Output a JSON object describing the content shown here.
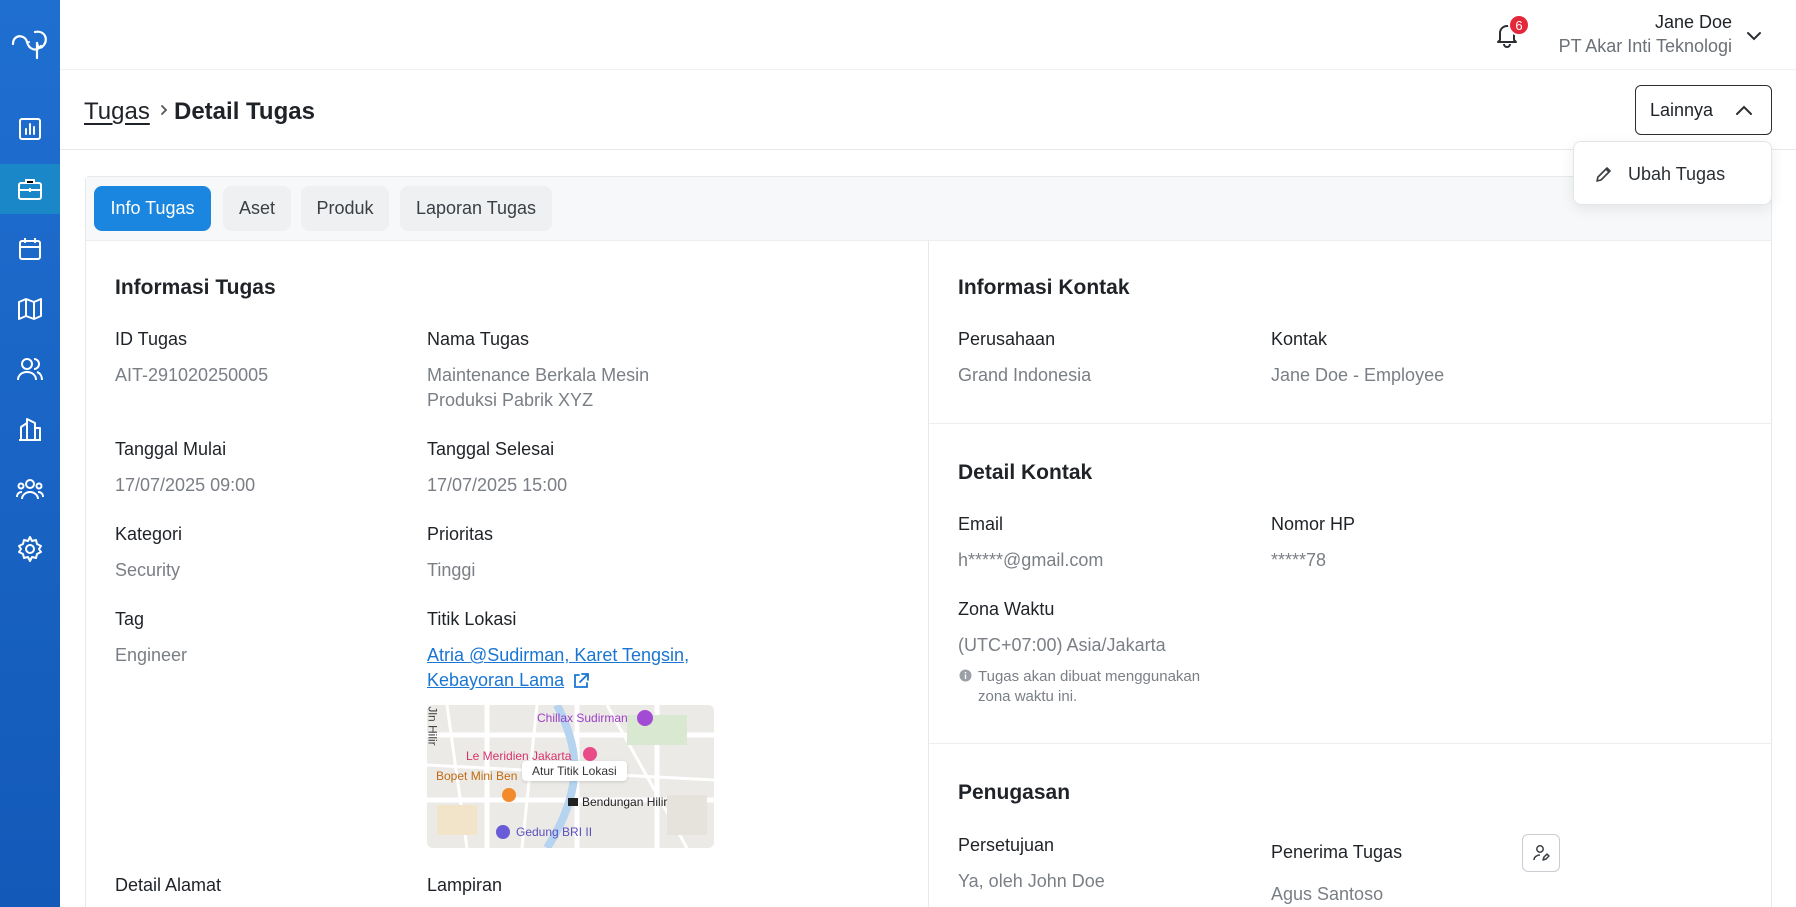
{
  "sidebar": {
    "logo": "logo-icon",
    "items": [
      {
        "icon": "chart-icon",
        "active": false
      },
      {
        "icon": "briefcase-icon",
        "active": true
      },
      {
        "icon": "calendar-icon",
        "active": false
      },
      {
        "icon": "map-icon",
        "active": false
      },
      {
        "icon": "users-icon",
        "active": false
      },
      {
        "icon": "building-icon",
        "active": false
      },
      {
        "icon": "team-icon",
        "active": false
      },
      {
        "icon": "gear-icon",
        "active": false
      }
    ]
  },
  "header": {
    "notification_count": "6",
    "user_name": "Jane Doe",
    "user_company": "PT Akar Inti Teknologi"
  },
  "breadcrumb": {
    "parent": "Tugas",
    "current": "Detail Tugas"
  },
  "actions": {
    "more_label": "Lainnya",
    "dropdown_items": [
      {
        "label": "Ubah Tugas",
        "icon": "pencil-icon"
      }
    ]
  },
  "tabs": [
    {
      "label": "Info Tugas",
      "active": true
    },
    {
      "label": "Aset",
      "active": false
    },
    {
      "label": "Produk",
      "active": false
    },
    {
      "label": "Laporan Tugas",
      "active": false
    }
  ],
  "task_info": {
    "title": "Informasi Tugas",
    "id_label": "ID Tugas",
    "id_value": "AIT-291020250005",
    "name_label": "Nama Tugas",
    "name_value_line1": "Maintenance Berkala Mesin",
    "name_value_line2": "Produksi Pabrik XYZ",
    "start_label": "Tanggal Mulai",
    "start_value": "17/07/2025 09:00",
    "end_label": "Tanggal Selesai",
    "end_value": "17/07/2025 15:00",
    "category_label": "Kategori",
    "category_value": "Security",
    "priority_label": "Prioritas",
    "priority_value": "Tinggi",
    "tag_label": "Tag",
    "tag_value": "Engineer",
    "location_label": "Titik Lokasi",
    "location_line1": "Atria @Sudirman, Karet Tengsin,",
    "location_line2": "Kebayoran Lama",
    "map": {
      "pill": "Atur Titik Lokasi",
      "places": [
        "Chillax Sudirman",
        "Le Meridien Jakarta",
        "Bopet Mini Ben",
        "Bendungan Hilir",
        "Gedung BRI II",
        "Jln Hilir"
      ]
    },
    "address_label": "Detail Alamat",
    "attachment_label": "Lampiran"
  },
  "contact_info": {
    "title": "Informasi Kontak",
    "company_label": "Perusahaan",
    "company_value": "Grand Indonesia",
    "contact_label": "Kontak",
    "contact_value": "Jane Doe - Employee"
  },
  "contact_detail": {
    "title": "Detail Kontak",
    "email_label": "Email",
    "email_value": "h*****@gmail.com",
    "phone_label": "Nomor HP",
    "phone_value": "*****78",
    "tz_label": "Zona Waktu",
    "tz_value": "(UTC+07:00) Asia/Jakarta",
    "tz_hint_line1": "Tugas akan dibuat menggunakan",
    "tz_hint_line2": "zona waktu ini."
  },
  "assignment": {
    "title": "Penugasan",
    "approval_label": "Persetujuan",
    "approval_value": "Ya, oleh John Doe",
    "assignee_label": "Penerima Tugas",
    "assignee_value": "Agus Santoso"
  }
}
